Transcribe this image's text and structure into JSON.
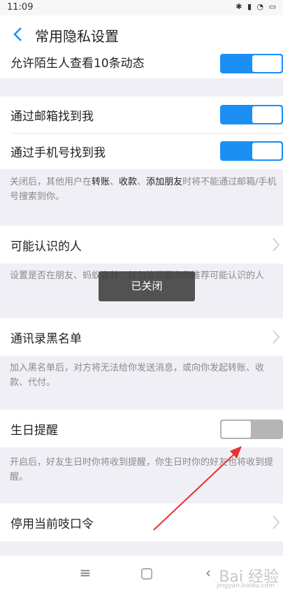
{
  "status_bar": {
    "time": "11:09",
    "icons": "✱ ▮ ◔ ▭"
  },
  "header": {
    "title": "常用隐私设置"
  },
  "rows": {
    "stranger_posts": {
      "label": "允许陌生人查看10条动态",
      "toggle": "on"
    },
    "email": {
      "label": "通过邮箱找到我",
      "toggle": "on"
    },
    "phone": {
      "label": "通过手机号找到我",
      "toggle": "on"
    },
    "may_know": {
      "label": "可能认识的人"
    },
    "blacklist": {
      "label": "通讯录黑名单"
    },
    "birthday": {
      "label": "生日提醒",
      "toggle": "off"
    },
    "kouling": {
      "label": "停用当前吱口令"
    }
  },
  "notes": {
    "contact": {
      "p1": "关闭后，其他用户在",
      "b1": "转账",
      "p2": "、",
      "b2": "收款",
      "p3": "、",
      "b3": "添加朋友",
      "p4": "时将不能通过邮箱/手机号搜索到你。"
    },
    "may_know": "设置是否在朋友、蚂蚁森林、红包等页面向你推荐可能认识的人",
    "blacklist": "加入黑名单后，对方将无法给你发送消息，或向你发起转账、收款、代付。",
    "birthday": "开启后，好友生日时你将收到提醒，你生日时你的好友也将收到提醒。"
  },
  "toast": "已关闭",
  "nav": {
    "menu": "≡",
    "home": "▢",
    "back": "‹"
  },
  "watermark": {
    "text": "Bai 经验",
    "sub": "jingyan.baidu.com"
  },
  "colors": {
    "accent": "#1c8ff4",
    "arrow": "#e8312c",
    "toggle_off": "#b5b5b5"
  }
}
